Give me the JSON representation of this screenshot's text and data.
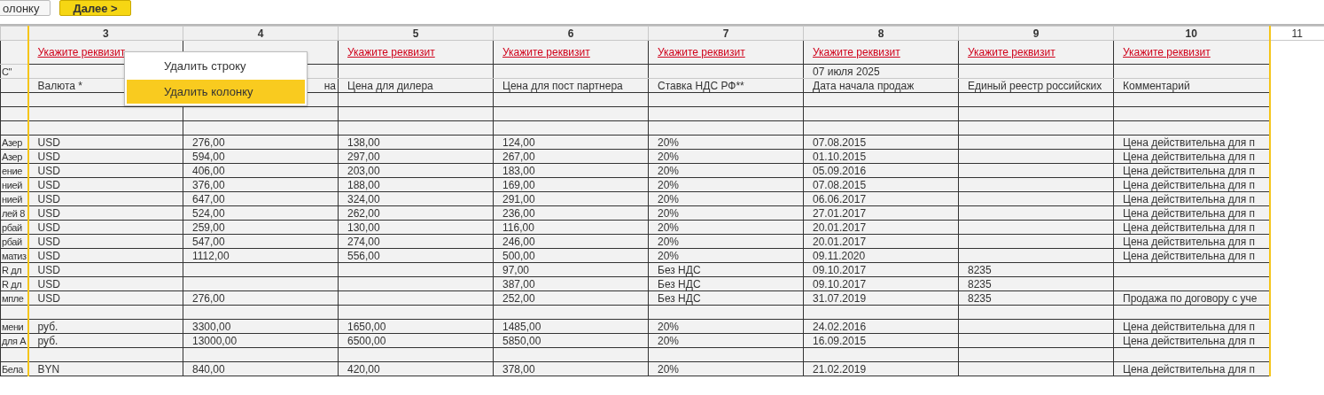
{
  "toolbar": {
    "buttons": [
      {
        "label": "олонку",
        "kind": "default"
      },
      {
        "label": "Далее >",
        "kind": "primary"
      }
    ]
  },
  "table": {
    "column_numbers": [
      "3",
      "4",
      "5",
      "6",
      "7",
      "8",
      "9",
      "10",
      "11"
    ],
    "requisite_links": {
      "col_3": "Укажите реквизит",
      "col_5": "Укажите реквизит",
      "col_6": "Укажите реквизит",
      "col_7": "Укажите реквизит",
      "col_8": "Укажите реквизит",
      "col_9": "Укажите реквизит",
      "col_10": "Укажите реквизит"
    },
    "rows": [
      {
        "kind": "data",
        "cells": {
          "col_2": "С\"",
          "col_8": "07 июля 2025"
        }
      },
      {
        "kind": "data",
        "cells": {
          "col_3": "Валюта *",
          "col_4": "на",
          "col_5": "Цена для дилера",
          "col_6": "Цена для пост партнера",
          "col_7": "Ставка НДС РФ**",
          "col_8": "Дата начала продаж",
          "col_9": "Единый реестр российских",
          "col_10": "Комментарий"
        }
      },
      {
        "kind": "blank"
      },
      {
        "kind": "blank"
      },
      {
        "kind": "blank"
      },
      {
        "kind": "data",
        "cells": {
          "col_2": "Азер",
          "col_3": "USD",
          "col_4": "276,00",
          "col_5": "138,00",
          "col_6": "124,00",
          "col_7": "20%",
          "col_8": "07.08.2015",
          "col_10": "Цена действительна для п"
        }
      },
      {
        "kind": "data",
        "cells": {
          "col_2": "Азер",
          "col_3": "USD",
          "col_4": "594,00",
          "col_5": "297,00",
          "col_6": "267,00",
          "col_7": "20%",
          "col_8": "01.10.2015",
          "col_10": "Цена действительна для п"
        }
      },
      {
        "kind": "data",
        "cells": {
          "col_2": "ение",
          "col_3": "USD",
          "col_4": "406,00",
          "col_5": "203,00",
          "col_6": "183,00",
          "col_7": "20%",
          "col_8": "05.09.2016",
          "col_10": "Цена действительна для п"
        }
      },
      {
        "kind": "data",
        "cells": {
          "col_2": "нией",
          "col_3": "USD",
          "col_4": "376,00",
          "col_5": "188,00",
          "col_6": "169,00",
          "col_7": "20%",
          "col_8": "07.08.2015",
          "col_10": "Цена действительна для п"
        }
      },
      {
        "kind": "data",
        "cells": {
          "col_2": "нией",
          "col_3": "USD",
          "col_4": "647,00",
          "col_5": "324,00",
          "col_6": "291,00",
          "col_7": "20%",
          "col_8": "06.06.2017",
          "col_10": "Цена действительна для п"
        }
      },
      {
        "kind": "data",
        "cells": {
          "col_2": "лей 8",
          "col_3": "USD",
          "col_4": "524,00",
          "col_5": "262,00",
          "col_6": "236,00",
          "col_7": "20%",
          "col_8": "27.01.2017",
          "col_10": "Цена действительна для п"
        }
      },
      {
        "kind": "data",
        "cells": {
          "col_2": "рбай",
          "col_3": "USD",
          "col_4": "259,00",
          "col_5": "130,00",
          "col_6": "116,00",
          "col_7": "20%",
          "col_8": "20.01.2017",
          "col_10": "Цена действительна для п"
        }
      },
      {
        "kind": "data",
        "cells": {
          "col_2": "рбай",
          "col_3": "USD",
          "col_4": "547,00",
          "col_5": "274,00",
          "col_6": "246,00",
          "col_7": "20%",
          "col_8": "20.01.2017",
          "col_10": "Цена действительна для п"
        }
      },
      {
        "kind": "data",
        "cells": {
          "col_2": "матиз",
          "col_3": "USD",
          "col_4": "1112,00",
          "col_5": "556,00",
          "col_6": "500,00",
          "col_7": "20%",
          "col_8": "09.11.2020",
          "col_10": "Цена действительна для п"
        }
      },
      {
        "kind": "data",
        "cells": {
          "col_2": "R дл",
          "col_3": "USD",
          "col_6": "97,00",
          "col_7": "Без НДС",
          "col_8": "09.10.2017",
          "col_9": "8235"
        }
      },
      {
        "kind": "data",
        "cells": {
          "col_2": "R дл",
          "col_3": "USD",
          "col_6": "387,00",
          "col_7": "Без НДС",
          "col_8": "09.10.2017",
          "col_9": "8235"
        }
      },
      {
        "kind": "data",
        "cells": {
          "col_2": "мпле",
          "col_3": "USD",
          "col_4": "276,00",
          "col_6": "252,00",
          "col_7": "Без НДС",
          "col_8": "31.07.2019",
          "col_9": "8235",
          "col_10": "Продажа по договору с уче"
        }
      },
      {
        "kind": "blank"
      },
      {
        "kind": "data",
        "cells": {
          "col_2": "мени",
          "col_3": "руб.",
          "col_4": "3300,00",
          "col_5": "1650,00",
          "col_6": "1485,00",
          "col_7": "20%",
          "col_8": "24.02.2016",
          "col_10": "Цена действительна для п"
        }
      },
      {
        "kind": "data",
        "cells": {
          "col_2": "для А",
          "col_3": "руб.",
          "col_4": "13000,00",
          "col_5": "6500,00",
          "col_6": "5850,00",
          "col_7": "20%",
          "col_8": "16.09.2015",
          "col_10": "Цена действительна для п"
        }
      },
      {
        "kind": "blank"
      },
      {
        "kind": "data",
        "cells": {
          "col_2": "Бела",
          "col_3": "BYN",
          "col_4": "840,00",
          "col_5": "420,00",
          "col_6": "378,00",
          "col_7": "20%",
          "col_8": "21.02.2019",
          "col_10": "Цена действительна для п"
        }
      }
    ]
  },
  "context_menu": {
    "items": [
      {
        "label": "Удалить строку",
        "selected": false
      },
      {
        "label": "Удалить колонку",
        "selected": true
      }
    ]
  }
}
